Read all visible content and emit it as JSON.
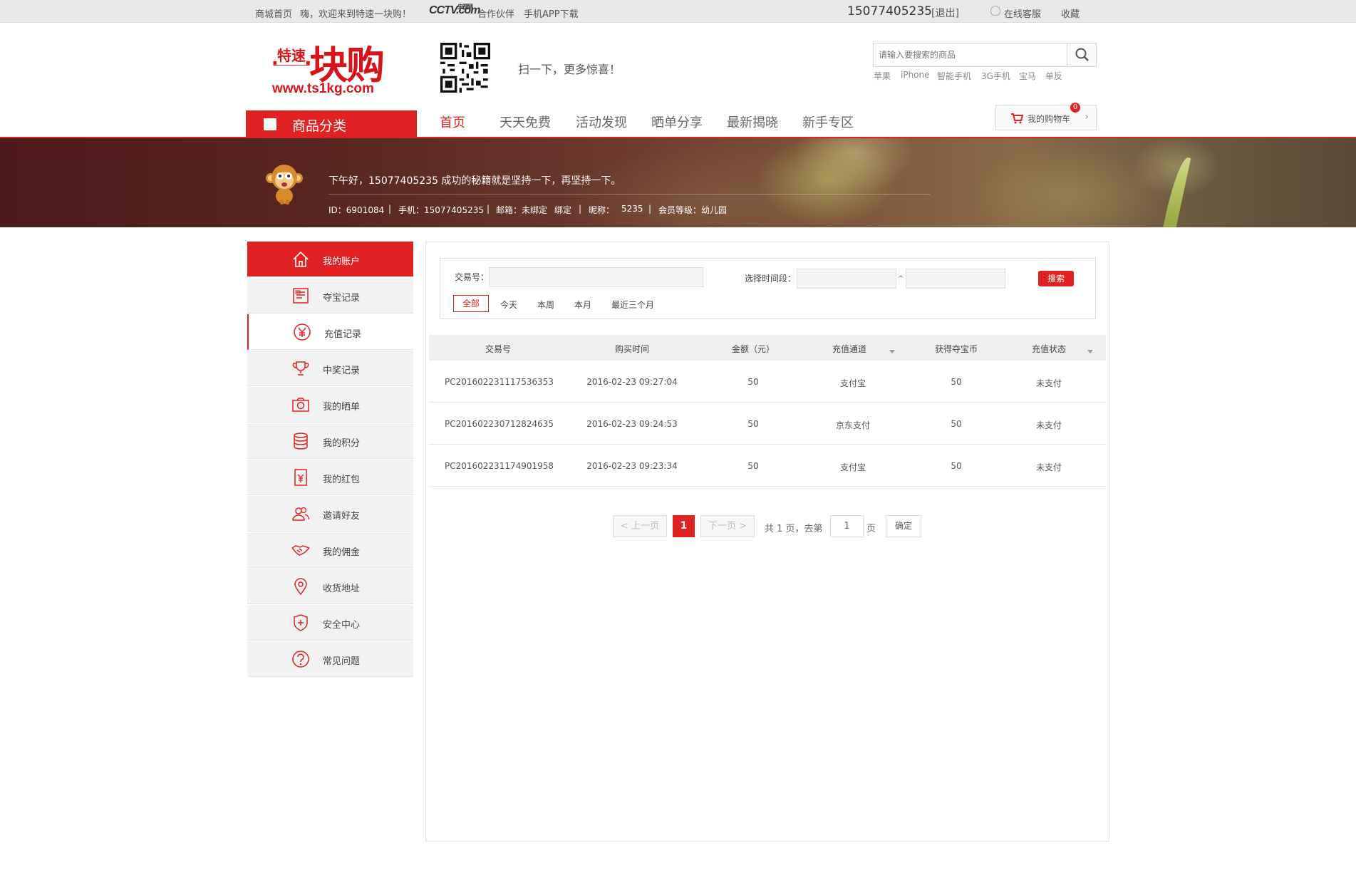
{
  "topbar": {
    "home_link": "商城首页",
    "welcome": "嗨，欢迎来到特速一块购！",
    "partner_logo": "CCTV.com",
    "partner_logo_small": "央视网",
    "partner": "合作伙伴",
    "app_download": "手机APP下载",
    "phone": "15077405235",
    "logout": "[退出]",
    "online_service": "在线客服",
    "favorite": "收藏"
  },
  "header": {
    "logo_small": "特速",
    "logo_main": "一块购",
    "logo_url": "www.ts1kg.com",
    "scan_text": "扫一下，更多惊喜！",
    "search_placeholder": "请输入要搜索的商品",
    "hot_words": [
      "苹果",
      "iPhone",
      "智能手机",
      "3G手机",
      "宝马",
      "单反"
    ]
  },
  "nav": {
    "category_label": "商品分类",
    "items": [
      "首页",
      "天天免费",
      "活动发现",
      "晒单分享",
      "最新揭晓",
      "新手专区"
    ],
    "active_index": 0,
    "cart_label": "我的购物车",
    "cart_count": "0"
  },
  "banner": {
    "greeting": "下午好，15077405235 成功的秘籍就是坚持一下，再坚持一下。",
    "id_text": "ID：6901084",
    "phone_text": "手机：15077405235",
    "email_text": "邮箱：未绑定",
    "bind_link": "绑定",
    "nickname_label": "昵称：",
    "nickname": "5235",
    "level_text": "会员等级：幼儿园"
  },
  "sidebar": {
    "items": [
      {
        "label": "我的账户",
        "icon": "home-icon"
      },
      {
        "label": "夺宝记录",
        "icon": "document-icon"
      },
      {
        "label": "充值记录",
        "icon": "yen-icon"
      },
      {
        "label": "中奖记录",
        "icon": "trophy-icon"
      },
      {
        "label": "我的晒单",
        "icon": "camera-icon"
      },
      {
        "label": "我的积分",
        "icon": "coins-icon"
      },
      {
        "label": "我的红包",
        "icon": "red-packet-icon"
      },
      {
        "label": "邀请好友",
        "icon": "users-icon"
      },
      {
        "label": "我的佣金",
        "icon": "handshake-icon"
      },
      {
        "label": "收货地址",
        "icon": "location-pin-icon"
      },
      {
        "label": "安全中心",
        "icon": "shield-icon"
      },
      {
        "label": "常见问题",
        "icon": "question-icon"
      }
    ],
    "active_index": 0,
    "current_index": 2
  },
  "filter": {
    "trade_no_label": "交易号：",
    "trade_no_value": "",
    "date_range_label": "选择时间段：",
    "date_separator": "-",
    "search_button": "搜索",
    "quick_ranges": [
      "全部",
      "今天",
      "本周",
      "本月",
      "最近三个月"
    ],
    "quick_active_index": 0
  },
  "table": {
    "columns": [
      "交易号",
      "购买时间",
      "金额（元）",
      "充值通道",
      "获得夺宝币",
      "充值状态"
    ],
    "rows": [
      [
        "PC201602231117536353",
        "2016-02-23 09:27:04",
        "50",
        "支付宝",
        "50",
        "未支付"
      ],
      [
        "PC201602230712824635",
        "2016-02-23 09:24:53",
        "50",
        "京东支付",
        "50",
        "未支付"
      ],
      [
        "PC201602231174901958",
        "2016-02-23 09:23:34",
        "50",
        "支付宝",
        "50",
        "未支付"
      ]
    ]
  },
  "pagination": {
    "prev": "< 上一页",
    "current": "1",
    "next": "下一页 >",
    "total_text": "共 1 页，去第",
    "page_input": "1",
    "page_suffix": "页",
    "confirm": "确定"
  },
  "colors": {
    "accent": "#e02222",
    "sidebar_bg": "#f2f2f2",
    "topbar_bg": "#e9e9e9"
  }
}
